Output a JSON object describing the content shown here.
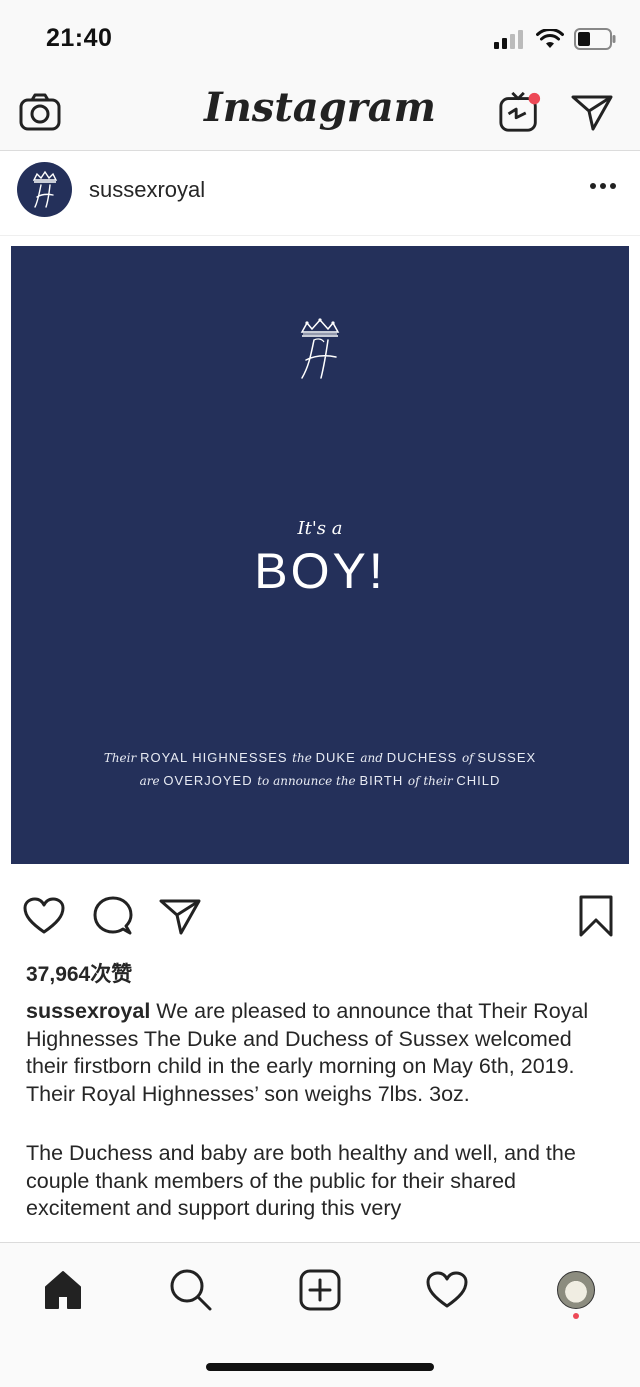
{
  "status_bar": {
    "time": "21:40"
  },
  "header": {
    "title": "Instagram"
  },
  "post": {
    "username": "sussexroyal",
    "image": {
      "monogram": "H",
      "line_small": "It's a",
      "line_big": "BOY!",
      "footer_line1": [
        {
          "t": "Their ",
          "it": true
        },
        {
          "t": "ROYAL HIGHNESSES ",
          "it": false
        },
        {
          "t": "the ",
          "it": true
        },
        {
          "t": "DUKE ",
          "it": false
        },
        {
          "t": "and ",
          "it": true
        },
        {
          "t": "DUCHESS ",
          "it": false
        },
        {
          "t": "of ",
          "it": true
        },
        {
          "t": "SUSSEX",
          "it": false
        }
      ],
      "footer_line2": [
        {
          "t": "are ",
          "it": true
        },
        {
          "t": "OVERJOYED ",
          "it": false
        },
        {
          "t": "to announce the ",
          "it": true
        },
        {
          "t": "BIRTH ",
          "it": false
        },
        {
          "t": "of their ",
          "it": true
        },
        {
          "t": "CHILD",
          "it": false
        }
      ]
    },
    "likes": "37,964次赞",
    "caption_user": "sussexroyal",
    "caption_text": " We are pleased to announce that Their Royal Highnesses The Duke and Duchess of Sussex welcomed their firstborn child in the early morning on May 6th, 2019. Their Royal Highnesses’ son weighs 7lbs. 3oz.",
    "caption_paragraph2": "The Duchess and baby are  both healthy and well, and the couple thank members of the public for their shared excitement and support during this very"
  },
  "colors": {
    "post_bg": "#24305a",
    "notification": "#ed4956"
  },
  "icons": [
    "camera-icon",
    "igtv-icon",
    "direct-message-icon",
    "more-options-icon",
    "heart-icon",
    "comment-icon",
    "share-icon",
    "bookmark-icon",
    "home-icon",
    "search-icon",
    "add-post-icon",
    "activity-heart-icon"
  ]
}
